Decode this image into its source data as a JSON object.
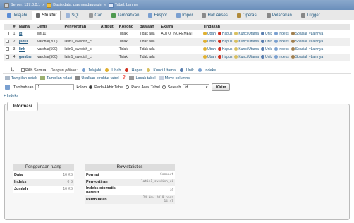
{
  "breadcrumb": {
    "server": "Server: 127.0.0.1",
    "database": "Basis data: pasmesdaguruin",
    "table": "Tabel: banner"
  },
  "tabs": [
    {
      "label": "Jelajahi",
      "icon": "browse-icon",
      "color": "#5b8dd6"
    },
    {
      "label": "Struktur",
      "icon": "structure-icon",
      "color": "#6a6a6a"
    },
    {
      "label": "SQL",
      "icon": "sql-icon",
      "color": "#9bb4d8"
    },
    {
      "label": "Cari",
      "icon": "search-icon",
      "color": "#999999"
    },
    {
      "label": "Tambahkan",
      "icon": "insert-icon",
      "color": "#4f9a4f"
    },
    {
      "label": "Ekspor",
      "icon": "export-icon",
      "color": "#7a9fd0"
    },
    {
      "label": "Impor",
      "icon": "import-icon",
      "color": "#7a9fd0"
    },
    {
      "label": "Hak Akses",
      "icon": "privileges-icon",
      "color": "#8a8a8a"
    },
    {
      "label": "Operasi",
      "icon": "wrench-icon",
      "color": "#b08a3a"
    },
    {
      "label": "Pelacakan",
      "icon": "eye-icon",
      "color": "#888888"
    },
    {
      "label": "Trigger",
      "icon": "trigger-icon",
      "color": "#888888"
    }
  ],
  "structure": {
    "headers": [
      "#",
      "Nama",
      "Jenis",
      "Penyortiran",
      "Atribut",
      "Kosong",
      "Bawaan",
      "Ekstra",
      "Tindakan"
    ],
    "rows": [
      {
        "num": "1",
        "name": "id",
        "type": "int(11)",
        "collation": "",
        "attr": "",
        "null": "Tidak",
        "default": "Tidak ada",
        "extra": "AUTO_INCREMENT"
      },
      {
        "num": "2",
        "name": "judul",
        "type": "varchar(200)",
        "collation": "latin1_swedish_ci",
        "attr": "",
        "null": "Tidak",
        "default": "Tidak ada",
        "extra": ""
      },
      {
        "num": "3",
        "name": "link",
        "type": "varchar(500)",
        "collation": "latin1_swedish_ci",
        "attr": "",
        "null": "Tidak",
        "default": "Tidak ada",
        "extra": ""
      },
      {
        "num": "4",
        "name": "gambar",
        "type": "varchar(500)",
        "collation": "latin1_swedish_ci",
        "attr": "",
        "null": "Tidak",
        "default": "Tidak ada",
        "extra": ""
      }
    ],
    "actions": [
      "Ubah",
      "Hapus",
      "Kunci Utama",
      "Unik",
      "Indeks",
      "Spasial",
      "Lainnya"
    ]
  },
  "bulk": {
    "check_all": "Pilih Semua",
    "with_selected": "Dengan pilihan:",
    "actions": [
      "Jelajahi",
      "Ubah",
      "Hapus",
      "Kunci Utama",
      "Unik",
      "Indeks"
    ]
  },
  "links": {
    "print": "Tampilan cetak",
    "relation": "Tampilan relasi",
    "propose": "Usulkan struktur tabel",
    "track": "Lacak tabel",
    "move": "Move columns"
  },
  "add": {
    "label": "Tambahkan",
    "count": "1",
    "unit": "kolom",
    "opt_end": "Pada Akhir Tabel",
    "opt_begin": "Pada Awal Tabel",
    "opt_after": "Setelah",
    "after_value": "id",
    "go": "Kirim"
  },
  "indexes_link": "+ Indeks",
  "info": {
    "legend": "Informasi",
    "space": {
      "title": "Penggunaan ruang",
      "rows": [
        {
          "label": "Data",
          "value": "16 KB"
        },
        {
          "label": "Indeks",
          "value": "0 B"
        },
        {
          "label": "Jumlah",
          "value": "16 KB"
        }
      ]
    },
    "stats": {
      "title": "Row statistics",
      "rows": [
        {
          "label": "Format",
          "value": "Compact"
        },
        {
          "label": "Penyortiran",
          "value": "latin1_swedish_ci"
        },
        {
          "label": "Indeks otomatis berikut",
          "value": "14"
        },
        {
          "label": "Pembuatan",
          "value": "24 Nov 2019 pada 14.47"
        }
      ]
    }
  }
}
